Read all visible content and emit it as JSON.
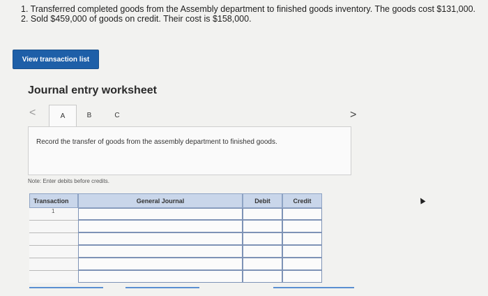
{
  "problem": {
    "line1": "1. Transferred completed goods from the Assembly department to finished goods inventory. The goods cost $131,000.",
    "line2": "2. Sold $459,000 of goods on credit. Their cost is $158,000."
  },
  "actions": {
    "view_list": "View transaction list"
  },
  "worksheet": {
    "title": "Journal entry worksheet",
    "nav_prev": "<",
    "nav_next": ">",
    "tabs": [
      "A",
      "B",
      "C"
    ],
    "active_tab": "A",
    "instruction": "Record the transfer of goods from the assembly department to finished goods.",
    "note": "Note: Enter debits before credits."
  },
  "table": {
    "headers": {
      "transaction": "Transaction",
      "journal": "General Journal",
      "debit": "Debit",
      "credit": "Credit"
    },
    "first_row_number": "1"
  },
  "colors": {
    "button": "#1e5fa8",
    "table_header": "#c9d6ea",
    "border": "#7e93b6"
  }
}
